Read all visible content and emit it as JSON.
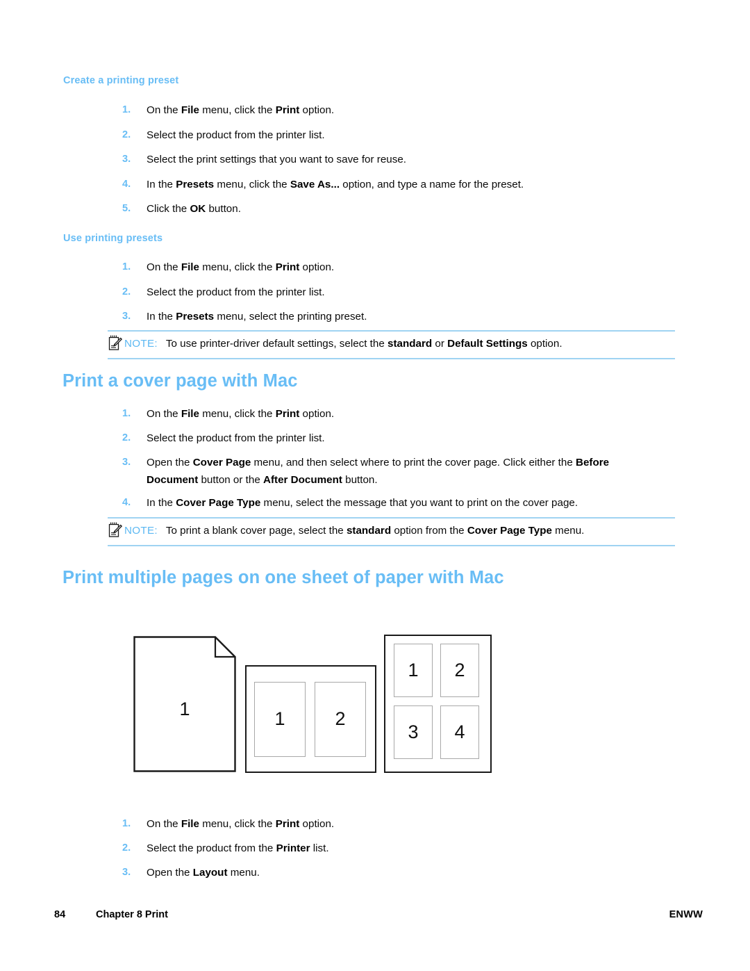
{
  "document": {
    "sections": [
      {
        "id": "create-preset",
        "heading": "Create a printing preset",
        "level": "h2",
        "steps": [
          {
            "num": "1.",
            "html": "On the <b>File</b> menu, click the <b>Print</b> option."
          },
          {
            "num": "2.",
            "html": "Select the product from the printer list."
          },
          {
            "num": "3.",
            "html": "Select the print settings that you want to save for reuse."
          },
          {
            "num": "4.",
            "html": "In the <b>Presets</b> menu, click the <b>Save As...</b> option, and type a name for the preset."
          },
          {
            "num": "5.",
            "html": "Click the <b>OK</b> button."
          }
        ]
      },
      {
        "id": "use-presets",
        "heading": "Use printing presets",
        "level": "h2",
        "steps": [
          {
            "num": "1.",
            "html": "On the <b>File</b> menu, click the <b>Print</b> option."
          },
          {
            "num": "2.",
            "html": "Select the product from the printer list."
          },
          {
            "num": "3.",
            "html": "In the <b>Presets</b> menu, select the printing preset."
          }
        ],
        "note": {
          "label": "NOTE:",
          "html": "To use printer-driver default settings, select the <b>standard </b>or <b>Default Settings</b> option."
        }
      },
      {
        "id": "cover-page",
        "heading": "Print a cover page with Mac",
        "level": "h1",
        "steps": [
          {
            "num": "1.",
            "html": "On the <b>File</b> menu, click the <b>Print</b> option."
          },
          {
            "num": "2.",
            "html": "Select the product from the printer list."
          },
          {
            "num": "3.",
            "html": "Open the <b>Cover Page</b> menu, and then select where to print the cover page. Click either the <b>Before Document</b> button or the <b>After Document</b> button."
          },
          {
            "num": "4.",
            "html": "In the <b>Cover Page Type</b> menu, select the message that you want to print on the cover page."
          }
        ],
        "note": {
          "label": "NOTE:",
          "html": "To print a blank cover page, select the <b>standard </b>option from the <b>Cover Page Type</b> menu."
        }
      },
      {
        "id": "multiple-pages",
        "heading": "Print multiple pages on one sheet of paper with Mac",
        "level": "h1",
        "steps": [
          {
            "num": "1.",
            "html": "On the <b>File</b> menu, click the <b>Print</b> option."
          },
          {
            "num": "2.",
            "html": "Select the product from the <b>Printer</b> list."
          },
          {
            "num": "3.",
            "html": "Open the <b>Layout</b> menu."
          }
        ]
      }
    ],
    "diagram": {
      "name": "pages-per-sheet-illustration",
      "sheets": [
        {
          "name": "single-page-sheet",
          "layout": "1-up",
          "labels": [
            "1"
          ]
        },
        {
          "name": "two-up-sheet",
          "layout": "2-up",
          "labels": [
            "1",
            "2"
          ]
        },
        {
          "name": "four-up-sheet",
          "layout": "4-up",
          "labels": [
            "1",
            "2",
            "3",
            "4"
          ]
        }
      ]
    },
    "footer": {
      "page_number": "84",
      "chapter": "Chapter 8  Print",
      "brand": "ENWW"
    },
    "colors": {
      "heading_blue": "#68bdf5",
      "note_rule_blue": "#9fd3f2",
      "note_label_blue": "#5cb8f2",
      "body_text": "#0a0a0a"
    }
  }
}
